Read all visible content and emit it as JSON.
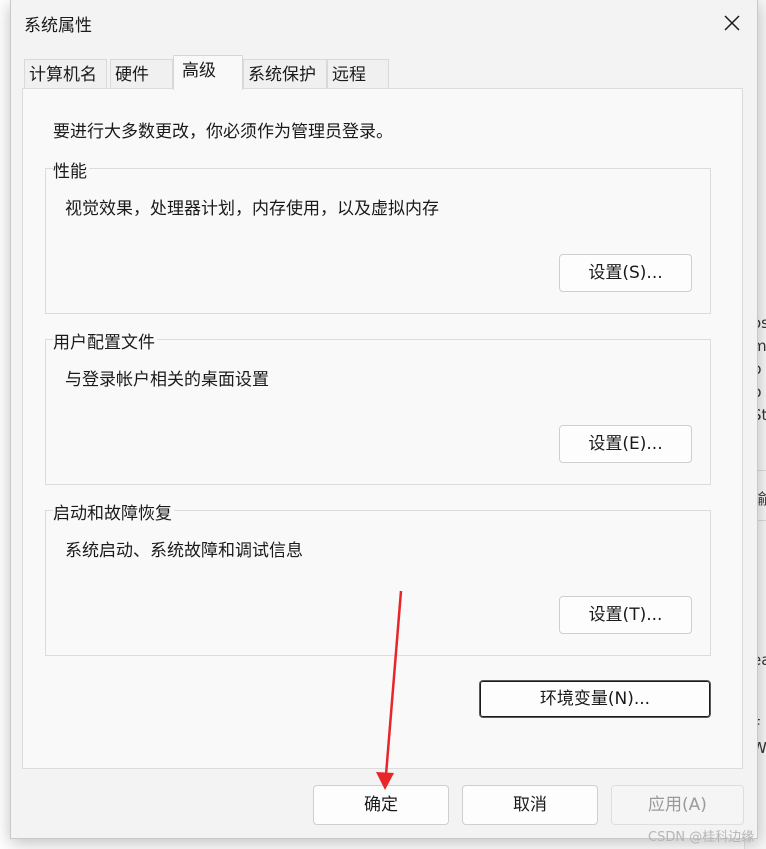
{
  "background_window": {
    "fragments": [
      "os",
      "m",
      "p",
      "p",
      "Sto",
      "輸",
      "ea",
      "F",
      "W"
    ]
  },
  "dialog": {
    "title": "系统属性",
    "close_glyph": "✕",
    "tabs": [
      {
        "label": "计算机名",
        "active": false
      },
      {
        "label": "硬件",
        "active": false
      },
      {
        "label": "高级",
        "active": true
      },
      {
        "label": "系统保护",
        "active": false
      },
      {
        "label": "远程",
        "active": false
      }
    ],
    "admin_note": "要进行大多数更改，你必须作为管理员登录。",
    "groups": {
      "performance": {
        "legend": "性能",
        "description": "视觉效果，处理器计划，内存使用，以及虚拟内存",
        "button": "设置(S)..."
      },
      "user_profiles": {
        "legend": "用户配置文件",
        "description": "与登录帐户相关的桌面设置",
        "button": "设置(E)..."
      },
      "startup_recovery": {
        "legend": "启动和故障恢复",
        "description": "系统启动、系统故障和调试信息",
        "button": "设置(T)..."
      }
    },
    "env_button": "环境变量(N)...",
    "footer": {
      "ok": "确定",
      "cancel": "取消",
      "apply": "应用(A)"
    }
  },
  "annotation": {
    "arrow_color": "#e8262a"
  },
  "watermark": "CSDN @桂科边缘"
}
